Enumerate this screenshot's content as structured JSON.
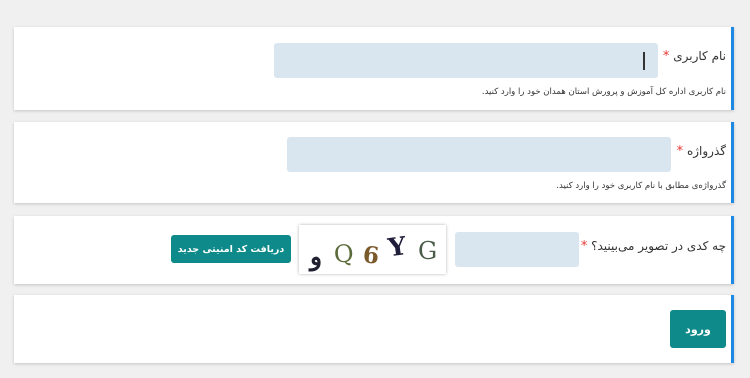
{
  "username": {
    "label": "نام کاربری",
    "required_mark": "*",
    "hint": "نام کاربری اداره کل آموزش و پرورش استان همدان خود را وارد کنید.",
    "value": ""
  },
  "password": {
    "label": "گذرواژه",
    "required_mark": "*",
    "hint": "گذرواژه‌ی مطابق با نام کاربری خود را وارد کنید.",
    "value": ""
  },
  "captcha": {
    "label": "چه کدی در تصویر می‌بینید؟",
    "required_mark": "*",
    "value": "",
    "refresh_label": "دریافت کد امنیتی جدید",
    "image_text": "وQ6YG"
  },
  "submit": {
    "label": "ورود"
  },
  "colors": {
    "accent": "#1e88e5",
    "button": "#0f8a8a",
    "input_bg": "#d9e6ef",
    "required": "#e53935"
  }
}
